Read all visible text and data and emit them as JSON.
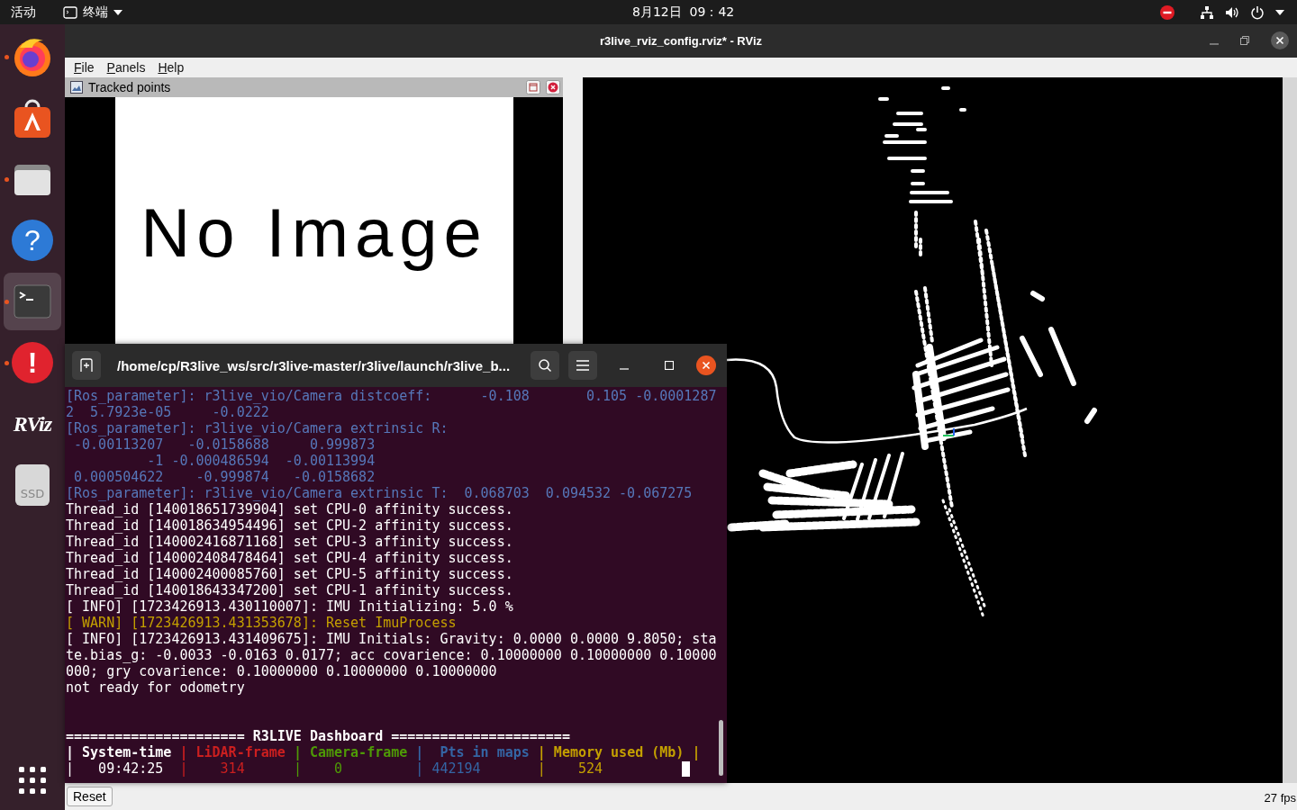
{
  "top_bar": {
    "activities": "活动",
    "app_menu": "终端",
    "clock": "8月12日  09：42"
  },
  "dock": {
    "items": [
      {
        "kind": "firefox",
        "running": true,
        "selected": false
      },
      {
        "kind": "software",
        "running": false,
        "selected": false
      },
      {
        "kind": "files",
        "running": true,
        "selected": false
      },
      {
        "kind": "help",
        "glyph": "?",
        "running": false,
        "selected": false
      },
      {
        "kind": "terminal",
        "running": true,
        "selected": true
      },
      {
        "kind": "update",
        "glyph": "!",
        "running": true,
        "selected": false
      },
      {
        "kind": "rviz",
        "glyph": "RViz",
        "running": false,
        "selected": false
      },
      {
        "kind": "ssd",
        "glyph": "SSD",
        "running": false,
        "selected": false
      }
    ]
  },
  "rviz": {
    "title": "r3live_rviz_config.rviz* - RViz",
    "menu": [
      "File",
      "Panels",
      "Help"
    ],
    "image_panel": {
      "title": "Tracked points",
      "message": "No Image"
    },
    "reset_button": "Reset",
    "fps": "27 fps"
  },
  "terminal": {
    "title": "/home/cp/R3live_ws/src/r3live-master/r3live/launch/r3live_b...",
    "lines": [
      {
        "text": "[Ros_parameter]: r3live_vio/Camera distcoeff:      -0.108       0.105 -0.0001287",
        "color": "#5677b9"
      },
      {
        "text": "2  5.7923e-05     -0.0222",
        "color": "#5677b9"
      },
      {
        "text": "[Ros_parameter]: r3live_vio/Camera extrinsic R:",
        "color": "#5677b9"
      },
      {
        "text": " -0.00113207   -0.0158688     0.999873",
        "color": "#5677b9"
      },
      {
        "text": "          -1 -0.000486594  -0.00113994",
        "color": "#5677b9"
      },
      {
        "text": " 0.000504622    -0.999874   -0.0158682",
        "color": "#5677b9"
      },
      {
        "text": "[Ros_parameter]: r3live_vio/Camera extrinsic T:  0.068703  0.094532 -0.067275",
        "color": "#5677b9"
      },
      {
        "text": "Thread_id [140018651739904] set CPU-0 affinity success.",
        "color": "#ffffff"
      },
      {
        "text": "Thread_id [140018634954496] set CPU-2 affinity success.",
        "color": "#ffffff"
      },
      {
        "text": "Thread_id [140002416871168] set CPU-3 affinity success.",
        "color": "#ffffff"
      },
      {
        "text": "Thread_id [140002408478464] set CPU-4 affinity success.",
        "color": "#ffffff"
      },
      {
        "text": "Thread_id [140002400085760] set CPU-5 affinity success.",
        "color": "#ffffff"
      },
      {
        "text": "Thread_id [140018643347200] set CPU-1 affinity success.",
        "color": "#ffffff"
      },
      {
        "text": "[ INFO] [1723426913.430110007]: IMU Initializing: 5.0 %",
        "color": "#ffffff"
      },
      {
        "text": "[ WARN] [1723426913.431353678]: Reset ImuProcess",
        "color": "#c4a000"
      },
      {
        "text": "[ INFO] [1723426913.431409675]: IMU Initials: Gravity: 0.0000 0.0000 9.8050; sta",
        "color": "#ffffff"
      },
      {
        "text": "te.bias_g: -0.0033 -0.0163 0.0177; acc covarience: 0.10000000 0.10000000 0.10000",
        "color": "#ffffff"
      },
      {
        "text": "000; gry covarience: 0.10000000 0.10000000 0.10000000",
        "color": "#ffffff"
      },
      {
        "text": "not ready for odometry",
        "color": "#ffffff"
      }
    ],
    "dashboard": {
      "title": "====================== R3LIVE Dashboard ======================",
      "header": [
        {
          "text": "| System-time ",
          "color": "#ffffff"
        },
        {
          "text": "| LiDAR-frame ",
          "color": "#cc1f1f"
        },
        {
          "text": "| Camera-frame ",
          "color": "#4e9a06"
        },
        {
          "text": "|  Pts in maps ",
          "color": "#3465a4"
        },
        {
          "text": "| Memory used (Mb) |",
          "color": "#c4a000"
        }
      ],
      "values": [
        {
          "text": "|   09:42:25  ",
          "color": "#ffffff"
        },
        {
          "text": "|    314      ",
          "color": "#cc1f1f"
        },
        {
          "text": "|    0         ",
          "color": "#4e9a06"
        },
        {
          "text": "| 442194       ",
          "color": "#3465a4"
        },
        {
          "text": "|    524",
          "color": "#c4a000"
        }
      ]
    }
  }
}
